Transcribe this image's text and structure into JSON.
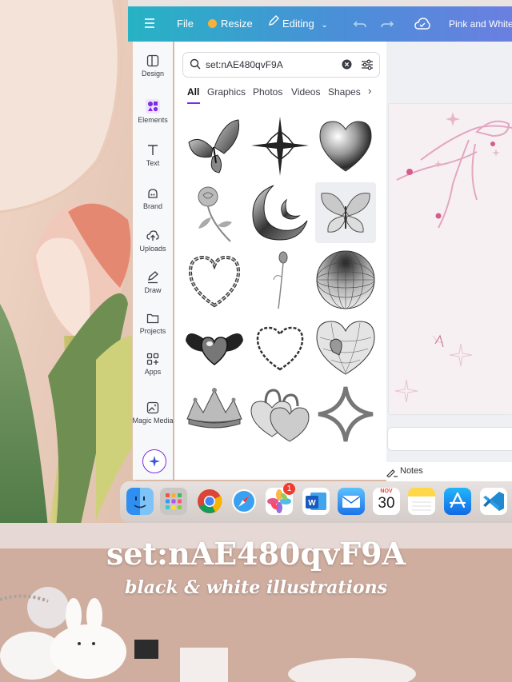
{
  "topbar": {
    "menu_icon": "hamburger-icon",
    "file_label": "File",
    "resize_label": "Resize",
    "editing_label": "Editing",
    "project_title": "Pink and White"
  },
  "sidebar": {
    "items": [
      {
        "label": "Design",
        "icon": "design-icon"
      },
      {
        "label": "Elements",
        "icon": "elements-icon"
      },
      {
        "label": "Text",
        "icon": "text-icon"
      },
      {
        "label": "Brand",
        "icon": "brand-icon"
      },
      {
        "label": "Uploads",
        "icon": "uploads-icon"
      },
      {
        "label": "Draw",
        "icon": "draw-icon"
      },
      {
        "label": "Projects",
        "icon": "projects-icon"
      },
      {
        "label": "Apps",
        "icon": "apps-icon"
      },
      {
        "label": "Magic Media",
        "icon": "magic-media-icon"
      }
    ]
  },
  "search": {
    "value": "set:nAE480qvF9A"
  },
  "tabs": [
    "All",
    "Graphics",
    "Photos",
    "Videos",
    "Shapes"
  ],
  "elements_grid": [
    "butterfly",
    "four-point-star",
    "chrome-heart",
    "rose",
    "crescent-moon",
    "butterfly-selected",
    "chain-heart",
    "flower-stem",
    "wireframe-sphere",
    "winged-heart",
    "barbed-heart",
    "mesh-heart",
    "crown",
    "padlock-hearts",
    "sparkle-star"
  ],
  "notes_label": "Notes",
  "dock": {
    "calendar_month": "NOV",
    "calendar_day": "30",
    "photos_badge": "1"
  },
  "caption": {
    "title": "set:nAE480qvF9A",
    "subtitle": "black & white illustrations"
  },
  "colors": {
    "topbar_start": "#26b3c4",
    "topbar_end": "#6a7fe0",
    "elements_accent": "#7d2ae8",
    "background": "#d8b9a6"
  }
}
